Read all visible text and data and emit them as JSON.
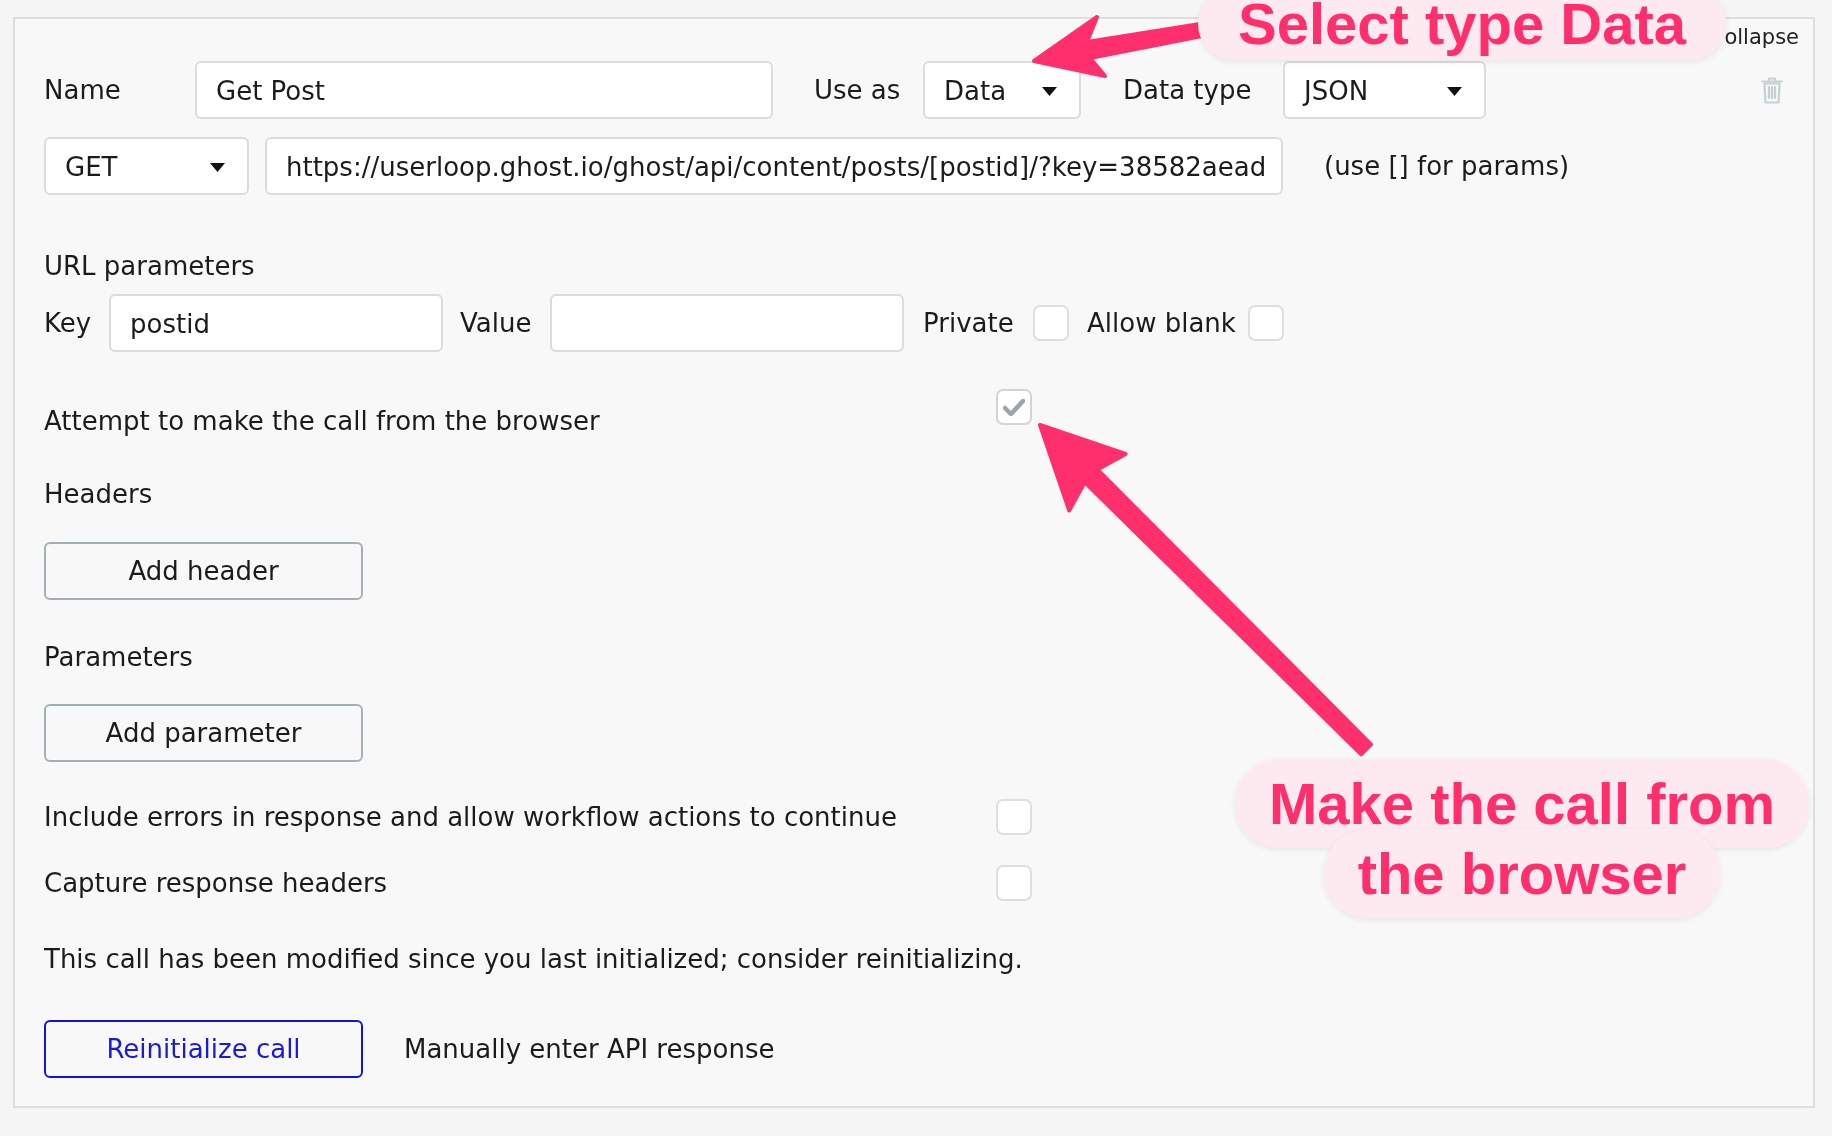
{
  "panel": {
    "collapse_link": "ollapse"
  },
  "call": {
    "name_label": "Name",
    "name": "Get Post",
    "use_as_label": "Use as",
    "use_as": "Data",
    "data_type_label": "Data type",
    "data_type": "JSON",
    "method": "GET",
    "url": "https://userloop.ghost.io/ghost/api/content/posts/[postid]/?key=38582aead",
    "url_hint": "(use [] for params)"
  },
  "url_parameters": {
    "title": "URL parameters",
    "items": [
      {
        "key_label": "Key",
        "key": "postid",
        "value_label": "Value",
        "private_label": "Private",
        "private": false,
        "allow_blank_label": "Allow blank",
        "allow_blank": false
      }
    ]
  },
  "browser_option": {
    "label": "Attempt to make the call from the browser",
    "checked": true
  },
  "headers": {
    "title": "Headers",
    "button": "Add header"
  },
  "parameters": {
    "title": "Parameters",
    "button": "Add parameter"
  },
  "response_options": [
    {
      "label": "Include errors in response and allow workflow actions to continue",
      "checked": false
    },
    {
      "label": "Capture response headers",
      "checked": false
    }
  ],
  "notice": "This call has been modified since you last initialized; consider reinitializing.",
  "actions": {
    "reinitialize": "Reinitialize call",
    "manual_entry": "Manually enter API response"
  },
  "annotations": [
    {
      "text": "Select type Data"
    },
    {
      "text": "Make the call from the browser"
    }
  ]
}
